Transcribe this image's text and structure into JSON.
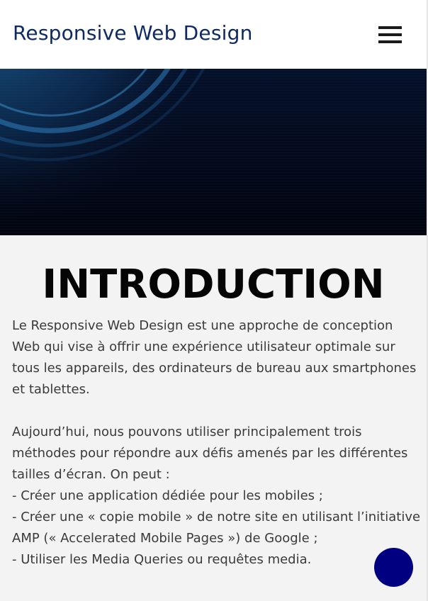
{
  "header": {
    "title": "Responsive Web Design"
  },
  "colors": {
    "title": "#0d2a63",
    "hero_background": "#040b1e",
    "content_background": "#f3f3f3",
    "scroll_button": "#000080"
  },
  "icons": {
    "menu": "hamburger-menu-icon"
  },
  "intro": {
    "heading": "INTRODUCTION",
    "lines": [
      "Le Responsive Web Design est une approche de conception",
      "Web qui vise à offrir une expérience utilisateur optimale sur",
      "tous les appareils, des ordinateurs de bureau aux smartphones",
      "et tablettes.",
      "",
      "Aujourd’hui, nous pouvons utiliser principalement trois",
      "méthodes pour répondre aux défis amenés par les différentes",
      "tailles d’écran. On peut :",
      "- Créer une application dédiée pour les mobiles ;",
      "- Créer une « copie mobile » de notre site en utilisant l’initiative",
      "AMP (« Accelerated Mobile Pages ») de Google ;",
      "- Utiliser les Media Queries ou requêtes media."
    ]
  }
}
